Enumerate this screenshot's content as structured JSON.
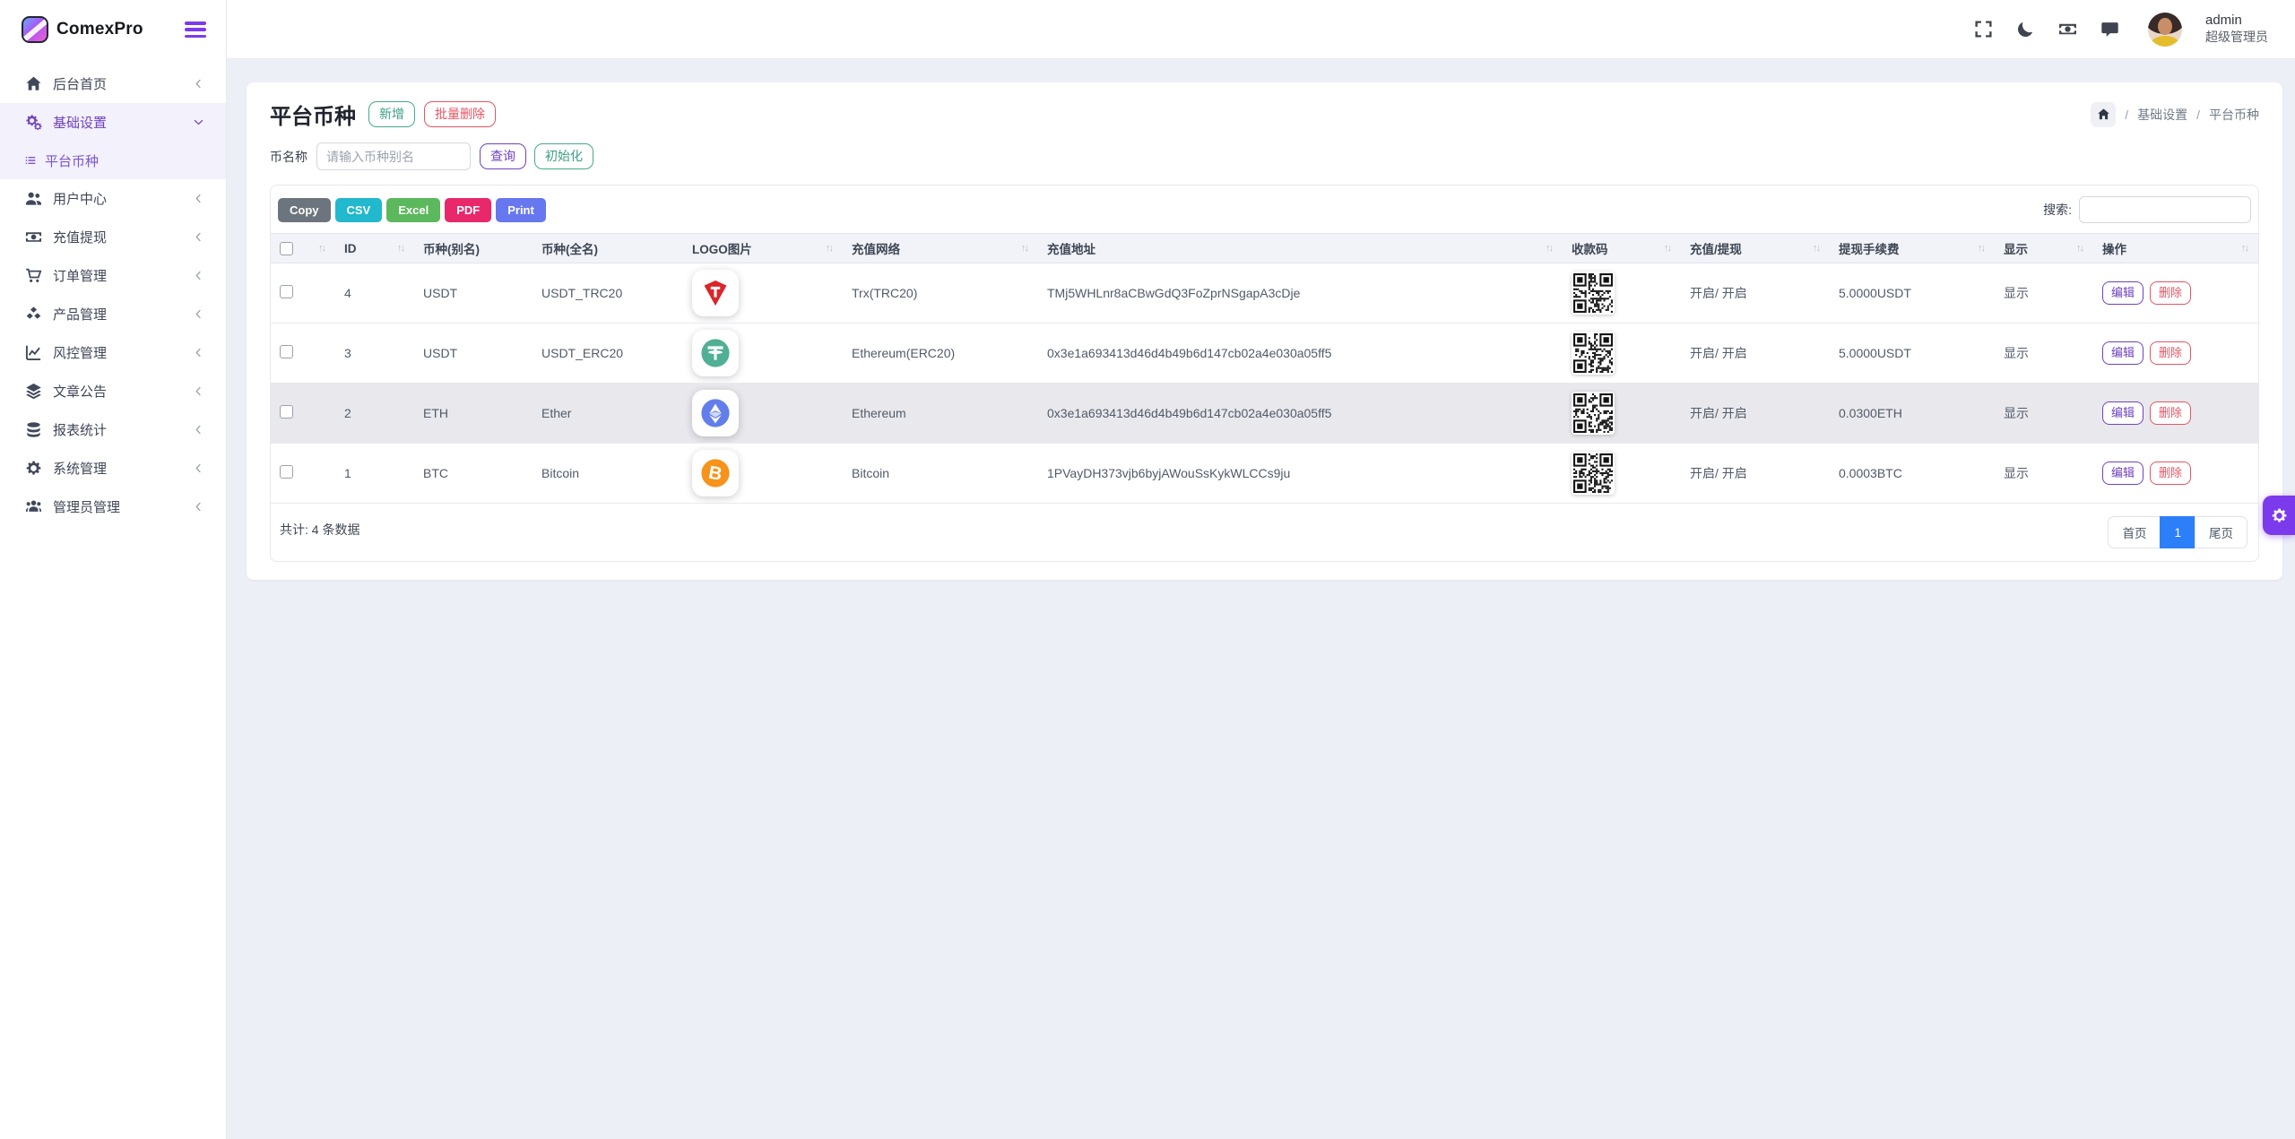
{
  "brand": {
    "name": "ComexPro"
  },
  "topbar": {
    "icons": [
      {
        "name": "fullscreen-icon"
      },
      {
        "name": "moon-icon"
      },
      {
        "name": "banknote-icon"
      },
      {
        "name": "chat-icon"
      }
    ],
    "user": {
      "name": "admin",
      "role": "超级管理员"
    }
  },
  "sidebar": {
    "items": [
      {
        "key": "dashboard",
        "label": "后台首页",
        "icon": "home-icon",
        "chevron": "left",
        "active": false
      },
      {
        "key": "basic-settings",
        "label": "基础设置",
        "icon": "gears-icon",
        "chevron": "down",
        "active": true,
        "children": [
          {
            "key": "platform-currency",
            "label": "平台币种",
            "icon": "list-icon",
            "active": true
          }
        ]
      },
      {
        "key": "user-center",
        "label": "用户中心",
        "icon": "users-icon",
        "chevron": "left",
        "active": false
      },
      {
        "key": "deposit-withdraw",
        "label": "充值提现",
        "icon": "banknote-icon",
        "chevron": "left",
        "active": false
      },
      {
        "key": "order-management",
        "label": "订单管理",
        "icon": "cart-icon",
        "chevron": "left",
        "active": false
      },
      {
        "key": "product-management",
        "label": "产品管理",
        "icon": "cubes-icon",
        "chevron": "left",
        "active": false
      },
      {
        "key": "risk-management",
        "label": "风控管理",
        "icon": "chart-line-icon",
        "chevron": "left",
        "active": false
      },
      {
        "key": "article-notice",
        "label": "文章公告",
        "icon": "layers-icon",
        "chevron": "left",
        "active": false
      },
      {
        "key": "report-statistics",
        "label": "报表统计",
        "icon": "coins-icon",
        "chevron": "left",
        "active": false
      },
      {
        "key": "system-management",
        "label": "系统管理",
        "icon": "gear-icon",
        "chevron": "left",
        "active": false
      },
      {
        "key": "admin-management",
        "label": "管理员管理",
        "icon": "user-group-icon",
        "chevron": "left",
        "active": false
      }
    ]
  },
  "page": {
    "title": "平台币种",
    "title_buttons": [
      {
        "label": "新增",
        "style": "success"
      },
      {
        "label": "批量删除",
        "style": "danger"
      }
    ],
    "breadcrumb": {
      "home_icon": "home-icon",
      "crumbs": [
        "基础设置",
        "平台币种"
      ]
    },
    "filter": {
      "label": "币名称",
      "placeholder": "请输入币种别名",
      "value": "",
      "buttons": [
        {
          "label": "查询",
          "style": "primary"
        },
        {
          "label": "初始化",
          "style": "success"
        }
      ]
    },
    "toolbar": {
      "export_buttons": [
        {
          "label": "Copy",
          "color": "#6c757d"
        },
        {
          "label": "CSV",
          "color": "#22b8cd"
        },
        {
          "label": "Excel",
          "color": "#5cb85c"
        },
        {
          "label": "PDF",
          "color": "#e8286b"
        },
        {
          "label": "Print",
          "color": "#6777ef"
        }
      ],
      "search_label": "搜索:",
      "search_value": ""
    },
    "table": {
      "columns": [
        {
          "label": "",
          "type": "checkbox",
          "sortable": true
        },
        {
          "label": "ID",
          "sortable": true
        },
        {
          "label": "币种(别名)",
          "sortable": false
        },
        {
          "label": "币种(全名)",
          "sortable": false
        },
        {
          "label": "LOGO图片",
          "sortable": true
        },
        {
          "label": "充值网络",
          "sortable": true
        },
        {
          "label": "充值地址",
          "sortable": true
        },
        {
          "label": "收款码",
          "sortable": true
        },
        {
          "label": "充值/提现",
          "sortable": true
        },
        {
          "label": "提现手续费",
          "sortable": true
        },
        {
          "label": "显示",
          "sortable": true
        },
        {
          "label": "操作",
          "sortable": true
        }
      ],
      "rows": [
        {
          "id": "4",
          "alias": "USDT",
          "fullname": "USDT_TRC20",
          "logo": "tron-logo",
          "logo_color": "#d8262c",
          "network": "Trx(TRC20)",
          "address": "TMj5WHLnr8aCBwGdQ3FoZprNSgapA3cDje",
          "qr": "qr-code",
          "deposit_withdraw": "开启/ 开启",
          "fee": "5.0000USDT",
          "display": "显示",
          "highlight": false
        },
        {
          "id": "3",
          "alias": "USDT",
          "fullname": "USDT_ERC20",
          "logo": "tether-logo",
          "logo_color": "#50af95",
          "network": "Ethereum(ERC20)",
          "address": "0x3e1a693413d46d4b49b6d147cb02a4e030a05ff5",
          "qr": "qr-code",
          "deposit_withdraw": "开启/ 开启",
          "fee": "5.0000USDT",
          "display": "显示",
          "highlight": false
        },
        {
          "id": "2",
          "alias": "ETH",
          "fullname": "Ether",
          "logo": "ethereum-logo",
          "logo_color": "#627eea",
          "network": "Ethereum",
          "address": "0x3e1a693413d46d4b49b6d147cb02a4e030a05ff5",
          "qr": "qr-code",
          "deposit_withdraw": "开启/ 开启",
          "fee": "0.0300ETH",
          "display": "显示",
          "highlight": true
        },
        {
          "id": "1",
          "alias": "BTC",
          "fullname": "Bitcoin",
          "logo": "bitcoin-logo",
          "logo_color": "#f7931a",
          "network": "Bitcoin",
          "address": "1PVayDH373vjb6byjAWouSsKykWLCCs9ju",
          "qr": "qr-code",
          "deposit_withdraw": "开启/ 开启",
          "fee": "0.0003BTC",
          "display": "显示",
          "highlight": false
        }
      ],
      "row_actions": [
        {
          "label": "编辑",
          "style": "primary"
        },
        {
          "label": "删除",
          "style": "danger"
        }
      ]
    },
    "footer": {
      "total_text": "共计: 4 条数据",
      "pagination": [
        {
          "label": "首页",
          "active": false
        },
        {
          "label": "1",
          "active": true
        },
        {
          "label": "尾页",
          "active": false
        }
      ]
    }
  },
  "fab": {
    "icon": "gear-icon"
  },
  "colors": {
    "accent_purple": "#6f42c1",
    "hamburger_violet": "#7c3aed",
    "success_teal": "#45a98c",
    "danger_red": "#e15664",
    "active_page_blue": "#2d7ff9",
    "page_background": "#edeff6"
  }
}
